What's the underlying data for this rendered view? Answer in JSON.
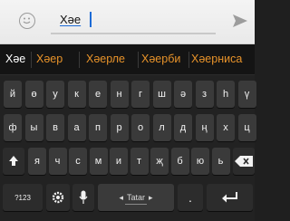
{
  "message_bar": {
    "input_value": "Хәе",
    "emoji_icon": "smiley-icon",
    "send_icon": "send-arrow-icon"
  },
  "suggestions": [
    "Хәе",
    "Хәер",
    "Хәерле",
    "Хәерби",
    "Хәерниса"
  ],
  "keyboard": {
    "row1": [
      "й",
      "ө",
      "у",
      "к",
      "е",
      "н",
      "г",
      "ш",
      "ә",
      "з",
      "һ",
      "ү"
    ],
    "row2": [
      "ф",
      "ы",
      "в",
      "а",
      "п",
      "р",
      "о",
      "л",
      "д",
      "ң",
      "х",
      "ц"
    ],
    "row3": [
      "я",
      "ч",
      "с",
      "м",
      "и",
      "т",
      "җ",
      "б",
      "ю",
      "ь"
    ],
    "numbers_label": "?123",
    "space_label": "Tatar",
    "period_label": ".",
    "shift_icon": "shift-arrow-icon",
    "backspace_icon": "backspace-icon",
    "settings_icon": "gear-icon",
    "mic_icon": "microphone-icon",
    "enter_icon": "enter-return-icon"
  },
  "colors": {
    "suggestion_accent": "#e8932a",
    "cursor_blue": "#1c6bd6",
    "key_bg": "#3a3a3a"
  }
}
